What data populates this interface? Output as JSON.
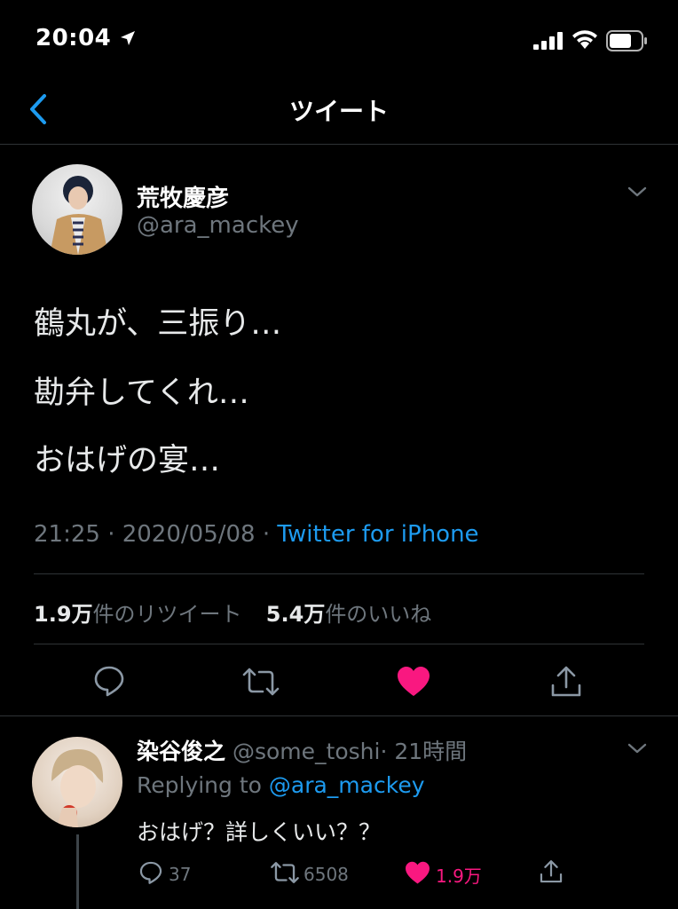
{
  "status_bar": {
    "time": "20:04"
  },
  "header": {
    "title": "ツイート"
  },
  "tweet": {
    "author_name": "荒牧慶彦",
    "author_handle": "@ara_mackey",
    "lines": [
      "鶴丸が、三振り…",
      "勘弁してくれ…",
      "おはげの宴…"
    ],
    "meta_time": "21:25 · 2020/05/08 · ",
    "meta_source": "Twitter for iPhone",
    "retweets": {
      "count": "1.9万",
      "label": "件のリツイート"
    },
    "likes": {
      "count": "5.4万",
      "label": "件のいいね"
    }
  },
  "reply": {
    "author_name": "染谷俊之",
    "author_handle": "@some_toshi",
    "time": "· 21時間",
    "replying_prefix": "Replying to ",
    "replying_to": "@ara_mackey",
    "text": "おはげ？詳しくいい？？",
    "reply_count": "37",
    "retweet_count": "6508",
    "like_count": "1.9万"
  },
  "colors": {
    "accent": "#1d9bf0",
    "like": "#f91880",
    "muted": "#6e767d",
    "background": "#000000"
  }
}
